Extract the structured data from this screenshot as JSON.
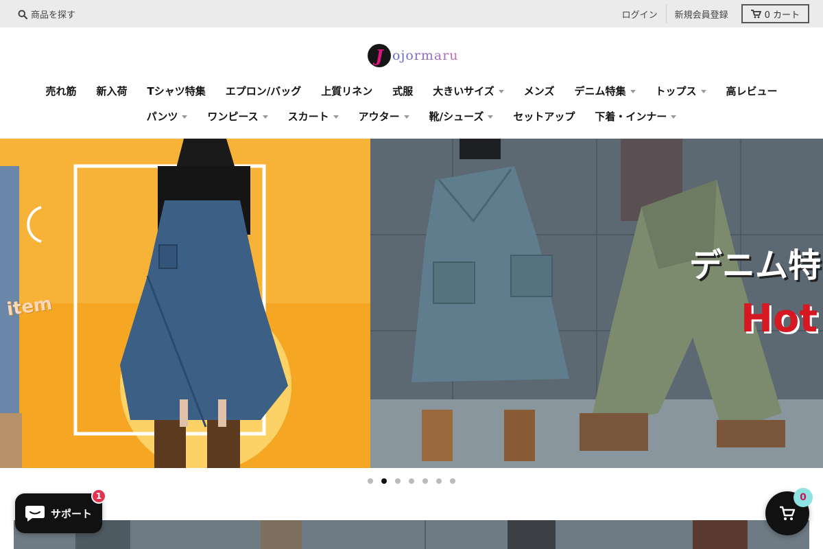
{
  "topbar": {
    "search_label": "商品を探す",
    "login_label": "ログイン",
    "register_label": "新規会員登録",
    "cart_label": "0 カート"
  },
  "logo": {
    "mark": "J",
    "text": "ojormaru"
  },
  "nav": {
    "row1": [
      {
        "label": "売れ筋",
        "dropdown": false
      },
      {
        "label": "新入荷",
        "dropdown": false
      },
      {
        "label": "Tシャツ特集",
        "dropdown": false
      },
      {
        "label": "エプロン/バッグ",
        "dropdown": false
      },
      {
        "label": "上質リネン",
        "dropdown": false
      },
      {
        "label": "式服",
        "dropdown": false
      },
      {
        "label": "大きいサイズ",
        "dropdown": true
      },
      {
        "label": "メンズ",
        "dropdown": false
      },
      {
        "label": "デニム特集",
        "dropdown": true
      },
      {
        "label": "トップス",
        "dropdown": true
      },
      {
        "label": "高レビュー",
        "dropdown": false
      }
    ],
    "row2": [
      {
        "label": "パンツ",
        "dropdown": true
      },
      {
        "label": "ワンピース",
        "dropdown": true
      },
      {
        "label": "スカート",
        "dropdown": true
      },
      {
        "label": "アウター",
        "dropdown": true
      },
      {
        "label": "靴/シューズ",
        "dropdown": true
      },
      {
        "label": "セットアップ",
        "dropdown": false
      },
      {
        "label": "下着・インナー",
        "dropdown": true
      }
    ]
  },
  "hero": {
    "left_overlay": "item",
    "right_overlay_title": "デニム特",
    "right_overlay_sub": "Hot",
    "slide_count": 7,
    "active_slide": 2
  },
  "chat": {
    "label": "サポート",
    "badge": "1"
  },
  "floating_cart": {
    "count": "0"
  },
  "colors": {
    "topbar_bg": "#ebebeb",
    "accent_pink": "#e0157f",
    "chat_badge": "#e8304f",
    "cart_badge": "#8de3e0",
    "hero_left_bg": "#f7b238"
  }
}
